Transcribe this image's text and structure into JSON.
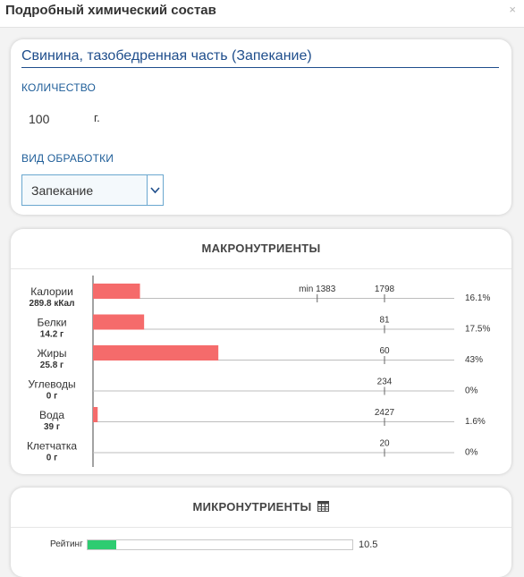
{
  "header": {
    "title": "Подробный химический состав",
    "close": "×"
  },
  "product": {
    "name": "Свинина, тазобедренная часть (Запекание)",
    "quantity_label": "КОЛИЧЕСТВО",
    "quantity_value": "100",
    "quantity_unit": "г.",
    "processing_label": "ВИД ОБРАБОТКИ",
    "processing_value": "Запекание"
  },
  "macro": {
    "title": "МАКРОНУТРИЕНТЫ",
    "norm_min_label": "min 1383",
    "rows": [
      {
        "name": "Калории",
        "amount": "289.8 кКал",
        "value": 289.8,
        "norm": 1798,
        "norm_label": "1798",
        "percent": "16.1%"
      },
      {
        "name": "Белки",
        "amount": "14.2 г",
        "value": 14.2,
        "norm": 81,
        "norm_label": "81",
        "percent": "17.5%"
      },
      {
        "name": "Жиры",
        "amount": "25.8 г",
        "value": 25.8,
        "norm": 60,
        "norm_label": "60",
        "percent": "43%"
      },
      {
        "name": "Углеводы",
        "amount": "0 г",
        "value": 0,
        "norm": 234,
        "norm_label": "234",
        "percent": "0%"
      },
      {
        "name": "Вода",
        "amount": "39 г",
        "value": 39,
        "norm": 2427,
        "norm_label": "2427",
        "percent": "1.6%"
      },
      {
        "name": "Клетчатка",
        "amount": "0 г",
        "value": 0,
        "norm": 20,
        "norm_label": "20",
        "percent": "0%"
      }
    ],
    "bar_color": "#f56b6b"
  },
  "micro": {
    "title": "МИКРОНУТРИЕНТЫ",
    "table_icon": "table-icon",
    "rating_label": "Рейтинг",
    "rating_value": "10.5",
    "rating_fraction": 0.107,
    "rating_color": "#2ecc71"
  }
}
